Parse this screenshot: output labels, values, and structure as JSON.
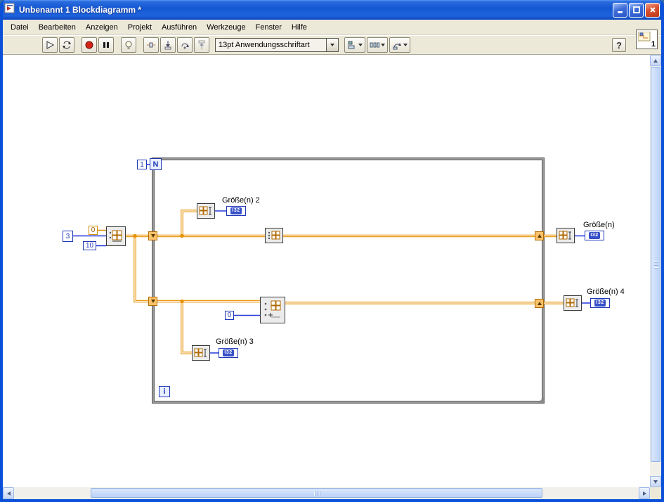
{
  "window": {
    "title": "Unbenannt 1 Blockdiagramm *",
    "badge": "1"
  },
  "menu": {
    "items": [
      {
        "label": "Datei"
      },
      {
        "label": "Bearbeiten"
      },
      {
        "label": "Anzeigen"
      },
      {
        "label": "Projekt"
      },
      {
        "label": "Ausführen"
      },
      {
        "label": "Werkzeuge"
      },
      {
        "label": "Fenster"
      },
      {
        "label": "Hilfe"
      }
    ]
  },
  "toolbar": {
    "font_selector": "13pt Anwendungsschriftart",
    "help_label": "?"
  },
  "diagram": {
    "for_loop": {
      "count_terminal": "N",
      "iteration_terminal": "i"
    },
    "constants": {
      "loop_count": "1",
      "array_value": "3",
      "element_value": "0",
      "dimension_size": "10",
      "index_value": "0"
    },
    "indicators": [
      {
        "label": "Größe(n) 2",
        "type": "I32"
      },
      {
        "label": "Größe(n)",
        "type": "I32"
      },
      {
        "label": "Größe(n) 3",
        "type": "I32"
      },
      {
        "label": "Größe(n) 4",
        "type": "I32"
      }
    ]
  }
}
